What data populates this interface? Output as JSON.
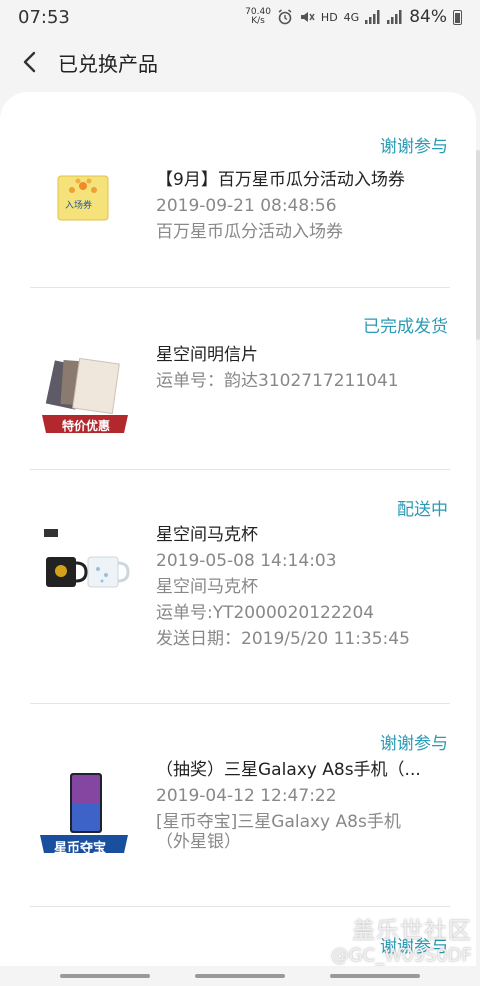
{
  "status_bar": {
    "time": "07:53",
    "net_speed_value": "70.40",
    "net_speed_unit": "K/s",
    "network_label": "HD",
    "network_type": "4G",
    "battery": "84%"
  },
  "header": {
    "title": "已兑换产品"
  },
  "orders": [
    {
      "status": "谢谢参与",
      "title": "【9月】百万星币瓜分活动入场券",
      "lines": [
        "2019-09-21 08:48:56",
        "百万星币瓜分活动入场券"
      ],
      "thumb_label": "入场券",
      "status_color": "#2b9ab5"
    },
    {
      "status": "已完成发货",
      "title": "星空间明信片",
      "lines": [
        "运单号：韵达3102717211041"
      ],
      "thumb_label": "特价优惠"
    },
    {
      "status": "配送中",
      "title": "星空间马克杯",
      "lines": [
        "2019-05-08 14:14:03",
        "星空间马克杯",
        "运单号:YT2000020122204",
        "发送日期：2019/5/20 11:35:45"
      ]
    },
    {
      "status": "谢谢参与",
      "title": "（抽奖）三星Galaxy A8s手机（...",
      "lines": [
        "2019-04-12 12:47:22",
        "[星币夺宝]三星Galaxy A8s手机",
        "（外星银）"
      ],
      "thumb_label": "星币夺宝"
    },
    {
      "status": "谢谢参与"
    }
  ],
  "watermark": {
    "brand": "盖乐世社区",
    "user": "@GC_W09S0DF"
  }
}
